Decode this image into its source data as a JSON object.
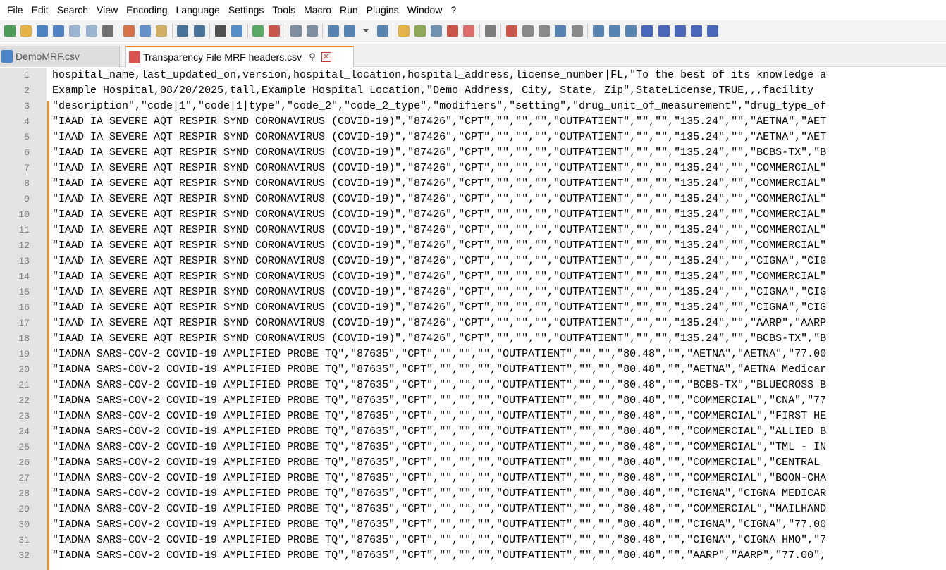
{
  "menu": [
    "File",
    "Edit",
    "Search",
    "View",
    "Encoding",
    "Language",
    "Settings",
    "Tools",
    "Macro",
    "Run",
    "Plugins",
    "Window",
    "?"
  ],
  "toolbar_icons": [
    {
      "name": "new-file-icon",
      "color": "#2e8b3a"
    },
    {
      "name": "open-file-icon",
      "color": "#e0a526"
    },
    {
      "name": "save-icon",
      "color": "#2f6fb8"
    },
    {
      "name": "save-all-icon",
      "color": "#2f6fb8"
    },
    {
      "name": "close-icon",
      "color": "#8aa8c8"
    },
    {
      "name": "close-all-icon",
      "color": "#8aa8c8"
    },
    {
      "name": "print-icon",
      "color": "#5a5a5a"
    },
    {
      "sep": true
    },
    {
      "name": "cut-icon",
      "color": "#d25a2a"
    },
    {
      "name": "copy-icon",
      "color": "#4a7fc1"
    },
    {
      "name": "paste-icon",
      "color": "#c9a04a"
    },
    {
      "sep": true
    },
    {
      "name": "undo-icon",
      "color": "#2a5d8a"
    },
    {
      "name": "redo-icon",
      "color": "#2a5d8a"
    },
    {
      "sep": true
    },
    {
      "name": "find-icon",
      "color": "#333333"
    },
    {
      "name": "replace-icon",
      "color": "#3a7abf"
    },
    {
      "sep": true
    },
    {
      "name": "zoom-in-icon",
      "color": "#3f9a4a"
    },
    {
      "name": "zoom-out-icon",
      "color": "#c0392b"
    },
    {
      "sep": true
    },
    {
      "name": "sync-vertical-icon",
      "color": "#6b7c8d"
    },
    {
      "name": "sync-horizontal-icon",
      "color": "#6b7c8d"
    },
    {
      "sep": true
    },
    {
      "name": "word-wrap-icon",
      "color": "#3a6ea5"
    },
    {
      "name": "show-all-chars-icon",
      "color": "#3a6ea5"
    },
    {
      "name": "dropdown-icon",
      "color": "#333333"
    },
    {
      "name": "indent-guide-icon",
      "color": "#3a6ea5"
    },
    {
      "sep": true
    },
    {
      "name": "user-language-icon",
      "color": "#e2a62b"
    },
    {
      "name": "document-map-icon",
      "color": "#7a9a3a"
    },
    {
      "name": "document-list-icon",
      "color": "#5a7fa5"
    },
    {
      "name": "function-list-icon",
      "color": "#c0392b"
    },
    {
      "name": "folder-workspace-icon",
      "color": "#d9534f"
    },
    {
      "sep": true
    },
    {
      "name": "monitoring-icon",
      "color": "#666666"
    },
    {
      "sep": true
    },
    {
      "name": "record-macro-icon",
      "color": "#c0392b"
    },
    {
      "name": "stop-macro-icon",
      "color": "#777777"
    },
    {
      "name": "play-macro-icon",
      "color": "#777777"
    },
    {
      "name": "run-macro-multiple-icon",
      "color": "#3a6ea5"
    },
    {
      "name": "save-macro-icon",
      "color": "#777777"
    },
    {
      "sep": true
    },
    {
      "name": "plugin-a-icon",
      "color": "#3a6ea5"
    },
    {
      "name": "plugin-b-icon",
      "color": "#3a6ea5"
    },
    {
      "name": "plugin-c-icon",
      "color": "#3a6ea5"
    },
    {
      "name": "collapse-icon",
      "color": "#2a4fb0"
    },
    {
      "name": "up-arrow-icon",
      "color": "#2a4fb0"
    },
    {
      "name": "down-arrow-icon",
      "color": "#2a4fb0"
    },
    {
      "name": "expand-icon",
      "color": "#2a4fb0"
    },
    {
      "name": "panel-icon",
      "color": "#2a4fb0"
    }
  ],
  "tabs": [
    {
      "label": "DemoMRF.csv",
      "active": false,
      "color": "#4a86c8"
    },
    {
      "label": "Transparency File MRF headers.csv",
      "active": true,
      "color": "#d9534f"
    }
  ],
  "tab_pin_glyph": "⚲",
  "tab_close_glyph": "✕",
  "editor": {
    "lines": [
      {
        "n": "1",
        "text": "hospital_name,last_updated_on,version,hospital_location,hospital_address,license_number|FL,\"To the best of its knowledge a"
      },
      {
        "n": "2",
        "text": "Example Hospital,08/20/2025,tall,Example Hospital Location,\"Demo Address, City, State, Zip\",StateLicense,TRUE,,,facility"
      },
      {
        "n": "3",
        "text": "\"description\",\"code|1\",\"code|1|type\",\"code_2\",\"code_2_type\",\"modifiers\",\"setting\",\"drug_unit_of_measurement\",\"drug_type_of"
      },
      {
        "n": "4",
        "text": "\"IAAD IA SEVERE AQT RESPIR SYND CORONAVIRUS (COVID-19)\",\"87426\",\"CPT\",\"\",\"\",\"\",\"OUTPATIENT\",\"\",\"\",\"135.24\",\"\",\"AETNA\",\"AET"
      },
      {
        "n": "5",
        "text": "\"IAAD IA SEVERE AQT RESPIR SYND CORONAVIRUS (COVID-19)\",\"87426\",\"CPT\",\"\",\"\",\"\",\"OUTPATIENT\",\"\",\"\",\"135.24\",\"\",\"AETNA\",\"AET"
      },
      {
        "n": "6",
        "text": "\"IAAD IA SEVERE AQT RESPIR SYND CORONAVIRUS (COVID-19)\",\"87426\",\"CPT\",\"\",\"\",\"\",\"OUTPATIENT\",\"\",\"\",\"135.24\",\"\",\"BCBS-TX\",\"B"
      },
      {
        "n": "7",
        "text": "\"IAAD IA SEVERE AQT RESPIR SYND CORONAVIRUS (COVID-19)\",\"87426\",\"CPT\",\"\",\"\",\"\",\"OUTPATIENT\",\"\",\"\",\"135.24\",\"\",\"COMMERCIAL\""
      },
      {
        "n": "8",
        "text": "\"IAAD IA SEVERE AQT RESPIR SYND CORONAVIRUS (COVID-19)\",\"87426\",\"CPT\",\"\",\"\",\"\",\"OUTPATIENT\",\"\",\"\",\"135.24\",\"\",\"COMMERCIAL\""
      },
      {
        "n": "9",
        "text": "\"IAAD IA SEVERE AQT RESPIR SYND CORONAVIRUS (COVID-19)\",\"87426\",\"CPT\",\"\",\"\",\"\",\"OUTPATIENT\",\"\",\"\",\"135.24\",\"\",\"COMMERCIAL\""
      },
      {
        "n": "10",
        "text": "\"IAAD IA SEVERE AQT RESPIR SYND CORONAVIRUS (COVID-19)\",\"87426\",\"CPT\",\"\",\"\",\"\",\"OUTPATIENT\",\"\",\"\",\"135.24\",\"\",\"COMMERCIAL\""
      },
      {
        "n": "11",
        "text": "\"IAAD IA SEVERE AQT RESPIR SYND CORONAVIRUS (COVID-19)\",\"87426\",\"CPT\",\"\",\"\",\"\",\"OUTPATIENT\",\"\",\"\",\"135.24\",\"\",\"COMMERCIAL\""
      },
      {
        "n": "12",
        "text": "\"IAAD IA SEVERE AQT RESPIR SYND CORONAVIRUS (COVID-19)\",\"87426\",\"CPT\",\"\",\"\",\"\",\"OUTPATIENT\",\"\",\"\",\"135.24\",\"\",\"COMMERCIAL\""
      },
      {
        "n": "13",
        "text": "\"IAAD IA SEVERE AQT RESPIR SYND CORONAVIRUS (COVID-19)\",\"87426\",\"CPT\",\"\",\"\",\"\",\"OUTPATIENT\",\"\",\"\",\"135.24\",\"\",\"CIGNA\",\"CIG"
      },
      {
        "n": "14",
        "text": "\"IAAD IA SEVERE AQT RESPIR SYND CORONAVIRUS (COVID-19)\",\"87426\",\"CPT\",\"\",\"\",\"\",\"OUTPATIENT\",\"\",\"\",\"135.24\",\"\",\"COMMERCIAL\""
      },
      {
        "n": "15",
        "text": "\"IAAD IA SEVERE AQT RESPIR SYND CORONAVIRUS (COVID-19)\",\"87426\",\"CPT\",\"\",\"\",\"\",\"OUTPATIENT\",\"\",\"\",\"135.24\",\"\",\"CIGNA\",\"CIG"
      },
      {
        "n": "16",
        "text": "\"IAAD IA SEVERE AQT RESPIR SYND CORONAVIRUS (COVID-19)\",\"87426\",\"CPT\",\"\",\"\",\"\",\"OUTPATIENT\",\"\",\"\",\"135.24\",\"\",\"CIGNA\",\"CIG"
      },
      {
        "n": "17",
        "text": "\"IAAD IA SEVERE AQT RESPIR SYND CORONAVIRUS (COVID-19)\",\"87426\",\"CPT\",\"\",\"\",\"\",\"OUTPATIENT\",\"\",\"\",\"135.24\",\"\",\"AARP\",\"AARP"
      },
      {
        "n": "18",
        "text": "\"IAAD IA SEVERE AQT RESPIR SYND CORONAVIRUS (COVID-19)\",\"87426\",\"CPT\",\"\",\"\",\"\",\"OUTPATIENT\",\"\",\"\",\"135.24\",\"\",\"BCBS-TX\",\"B"
      },
      {
        "n": "19",
        "text": "\"IADNA SARS-COV-2 COVID-19 AMPLIFIED PROBE TQ\",\"87635\",\"CPT\",\"\",\"\",\"\",\"OUTPATIENT\",\"\",\"\",\"80.48\",\"\",\"AETNA\",\"AETNA\",\"77.00"
      },
      {
        "n": "20",
        "text": "\"IADNA SARS-COV-2 COVID-19 AMPLIFIED PROBE TQ\",\"87635\",\"CPT\",\"\",\"\",\"\",\"OUTPATIENT\",\"\",\"\",\"80.48\",\"\",\"AETNA\",\"AETNA Medicar"
      },
      {
        "n": "21",
        "text": "\"IADNA SARS-COV-2 COVID-19 AMPLIFIED PROBE TQ\",\"87635\",\"CPT\",\"\",\"\",\"\",\"OUTPATIENT\",\"\",\"\",\"80.48\",\"\",\"BCBS-TX\",\"BLUECROSS B"
      },
      {
        "n": "22",
        "text": "\"IADNA SARS-COV-2 COVID-19 AMPLIFIED PROBE TQ\",\"87635\",\"CPT\",\"\",\"\",\"\",\"OUTPATIENT\",\"\",\"\",\"80.48\",\"\",\"COMMERCIAL\",\"CNA\",\"77"
      },
      {
        "n": "23",
        "text": "\"IADNA SARS-COV-2 COVID-19 AMPLIFIED PROBE TQ\",\"87635\",\"CPT\",\"\",\"\",\"\",\"OUTPATIENT\",\"\",\"\",\"80.48\",\"\",\"COMMERCIAL\",\"FIRST HE"
      },
      {
        "n": "24",
        "text": "\"IADNA SARS-COV-2 COVID-19 AMPLIFIED PROBE TQ\",\"87635\",\"CPT\",\"\",\"\",\"\",\"OUTPATIENT\",\"\",\"\",\"80.48\",\"\",\"COMMERCIAL\",\"ALLIED B"
      },
      {
        "n": "25",
        "text": "\"IADNA SARS-COV-2 COVID-19 AMPLIFIED PROBE TQ\",\"87635\",\"CPT\",\"\",\"\",\"\",\"OUTPATIENT\",\"\",\"\",\"80.48\",\"\",\"COMMERCIAL\",\"TML - IN"
      },
      {
        "n": "26",
        "text": "\"IADNA SARS-COV-2 COVID-19 AMPLIFIED PROBE TQ\",\"87635\",\"CPT\",\"\",\"\",\"\",\"OUTPATIENT\",\"\",\"\",\"80.48\",\"\",\"COMMERCIAL\",\"CENTRAL "
      },
      {
        "n": "27",
        "text": "\"IADNA SARS-COV-2 COVID-19 AMPLIFIED PROBE TQ\",\"87635\",\"CPT\",\"\",\"\",\"\",\"OUTPATIENT\",\"\",\"\",\"80.48\",\"\",\"COMMERCIAL\",\"BOON-CHA"
      },
      {
        "n": "28",
        "text": "\"IADNA SARS-COV-2 COVID-19 AMPLIFIED PROBE TQ\",\"87635\",\"CPT\",\"\",\"\",\"\",\"OUTPATIENT\",\"\",\"\",\"80.48\",\"\",\"CIGNA\",\"CIGNA MEDICAR"
      },
      {
        "n": "29",
        "text": "\"IADNA SARS-COV-2 COVID-19 AMPLIFIED PROBE TQ\",\"87635\",\"CPT\",\"\",\"\",\"\",\"OUTPATIENT\",\"\",\"\",\"80.48\",\"\",\"COMMERCIAL\",\"MAILHAND"
      },
      {
        "n": "30",
        "text": "\"IADNA SARS-COV-2 COVID-19 AMPLIFIED PROBE TQ\",\"87635\",\"CPT\",\"\",\"\",\"\",\"OUTPATIENT\",\"\",\"\",\"80.48\",\"\",\"CIGNA\",\"CIGNA\",\"77.00"
      },
      {
        "n": "31",
        "text": "\"IADNA SARS-COV-2 COVID-19 AMPLIFIED PROBE TQ\",\"87635\",\"CPT\",\"\",\"\",\"\",\"OUTPATIENT\",\"\",\"\",\"80.48\",\"\",\"CIGNA\",\"CIGNA HMO\",\"7"
      },
      {
        "n": "32",
        "text": "\"IADNA SARS-COV-2 COVID-19 AMPLIFIED PROBE TQ\",\"87635\",\"CPT\",\"\",\"\",\"\",\"OUTPATIENT\",\"\",\"\",\"80.48\",\"\",\"AARP\",\"AARP\",\"77.00\","
      }
    ]
  },
  "colors": {
    "gutter": "#e4e4e4",
    "change_bar": "#f58c1f",
    "active_tab_accent": "#fa8c2d",
    "line_number": "#808080"
  }
}
